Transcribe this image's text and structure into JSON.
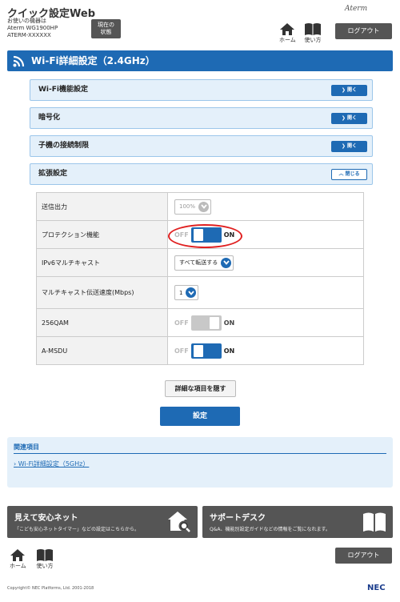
{
  "header": {
    "title": "クイック設定Web",
    "model_lines": [
      "お使いの機器は",
      "Aterm WG1900HP",
      "ATERM-XXXXXX"
    ],
    "status_button": [
      "現在の",
      "状態"
    ],
    "brand": "Aterm",
    "home_label": "ホーム",
    "help_label": "使い方",
    "logout_label": "ログアウト"
  },
  "page_heading": "Wi-Fi詳細設定（2.4GHz）",
  "accordions": [
    {
      "label": "Wi-Fi機能設定",
      "button": "開く",
      "state": "collapsed"
    },
    {
      "label": "暗号化",
      "button": "開く",
      "state": "collapsed"
    },
    {
      "label": "子機の接続制限",
      "button": "開く",
      "state": "collapsed"
    },
    {
      "label": "拡張設定",
      "button": "閉じる",
      "state": "expanded"
    }
  ],
  "settings": [
    {
      "label": "送信出力",
      "type": "select",
      "value": "100%",
      "disabled": true
    },
    {
      "label": "プロテクション機能",
      "type": "toggle",
      "off": "OFF",
      "on": "ON",
      "checked": true
    },
    {
      "label": "IPv6マルチキャスト",
      "type": "select",
      "value": "すべて転送する",
      "disabled": false
    },
    {
      "label": "マルチキャスト伝送速度(Mbps)",
      "type": "select",
      "value": "1",
      "disabled": false
    },
    {
      "label": "256QAM",
      "type": "toggle",
      "off": "OFF",
      "on": "ON",
      "checked": false,
      "disabled": true
    },
    {
      "label": "A-MSDU",
      "type": "toggle",
      "off": "OFF",
      "on": "ON",
      "checked": true
    }
  ],
  "buttons": {
    "hide_details": "詳細な項目を隠す",
    "save": "設定"
  },
  "related": {
    "title": "関連項目",
    "link": "Wi-Fi詳細設定（5GHz）"
  },
  "promos": [
    {
      "title": "見えて安心ネット",
      "desc": "「こども安心ネットタイマー」などの設定はこちらから。"
    },
    {
      "title": "サポートデスク",
      "desc": "Q&A、機能別設定ガイドなどの情報をご覧になれます。"
    }
  ],
  "footer": {
    "copyright": "Copyright© NEC Platforms, Ltd. 2001-2018",
    "brand": "NEC",
    "home_label": "ホーム",
    "help_label": "使い方",
    "logout_label": "ログアウト"
  },
  "colors": {
    "accent": "#1e6ab4",
    "panel": "#e4f0fa",
    "dark_button": "#555555",
    "highlight": "#e02020"
  }
}
